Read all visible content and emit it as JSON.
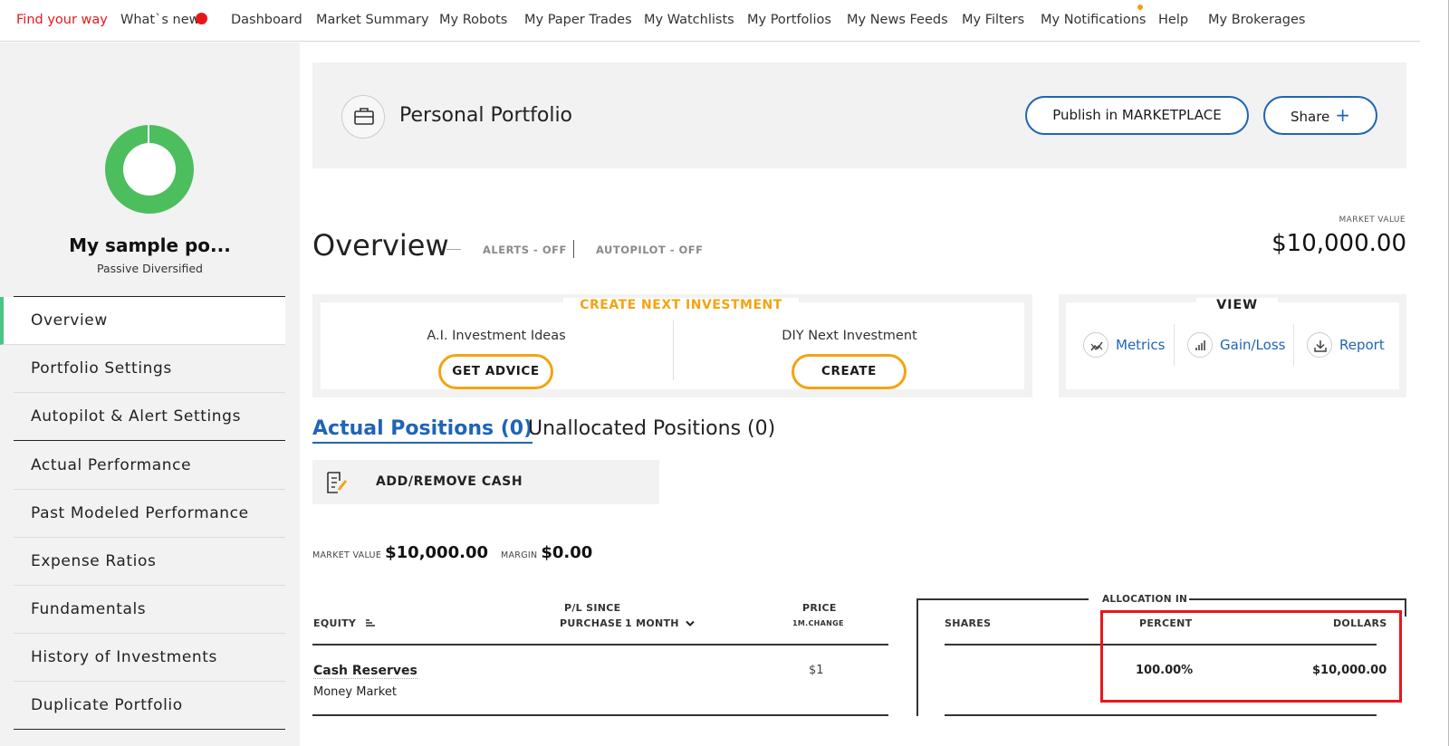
{
  "nav": {
    "items": [
      "Find your way",
      "What`s new",
      "Dashboard",
      "Market Summary",
      "My Robots",
      "My Paper Trades",
      "My Watchlists",
      "My Portfolios",
      "My News Feeds",
      "My Filters",
      "My Notifications",
      "Help",
      "My Brokerages"
    ]
  },
  "sidebar": {
    "portfolio_name": "My sample po...",
    "portfolio_type": "Passive Diversified",
    "menu": [
      "Overview",
      "Portfolio Settings",
      "Autopilot & Alert Settings",
      "Actual Performance",
      "Past Modeled Performance",
      "Expense Ratios",
      "Fundamentals",
      "History of Investments",
      "Duplicate Portfolio"
    ],
    "active_item": "Overview",
    "allocation_donut_percent": 100
  },
  "header": {
    "title": "Personal Portfolio",
    "publish_label": "Publish in MARKETPLACE",
    "share_label": "Share"
  },
  "overview": {
    "title": "Overview",
    "alerts_status": "ALERTS - OFF",
    "autopilot_status": "AUTOPILOT - OFF",
    "market_value_label": "MARKET VALUE",
    "market_value": "$10,000.00"
  },
  "create_next": {
    "title": "CREATE NEXT INVESTMENT",
    "ai_label": "A.I. Investment Ideas",
    "ai_button": "GET ADVICE",
    "diy_label": "DIY Next Investment",
    "diy_button": "CREATE"
  },
  "view": {
    "title": "VIEW",
    "links": [
      "Metrics",
      "Gain/Loss",
      "Report"
    ]
  },
  "tabs": {
    "actual": "Actual Positions (0)",
    "unallocated": "Unallocated Positions (0)"
  },
  "cash": {
    "label": "ADD/REMOVE CASH"
  },
  "summary": {
    "market_value_label": "MARKET VALUE",
    "market_value": "$10,000.00",
    "margin_label": "MARGIN",
    "margin": "$0.00"
  },
  "table": {
    "equity_header": "EQUITY",
    "pl_header_1": "P/L SINCE",
    "pl_header_2": "PURCHASE",
    "period": "1 MONTH",
    "price_header": "PRICE",
    "price_sub": "1M.CHANGE",
    "allocation_header": "ALLOCATION IN",
    "shares_header": "SHARES",
    "percent_header": "PERCENT",
    "dollars_header": "DOLLARS",
    "rows": [
      {
        "name": "Cash Reserves",
        "type": "Money Market",
        "price": "$1",
        "percent": "100.00%",
        "dollars": "$10,000.00"
      }
    ]
  }
}
